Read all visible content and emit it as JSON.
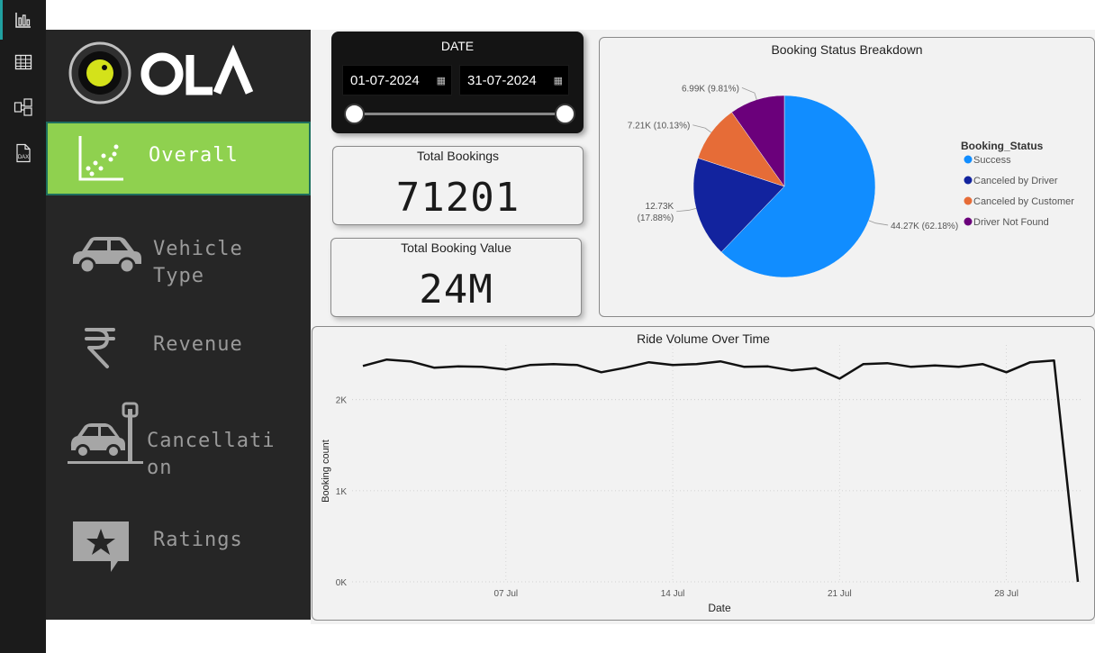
{
  "rail": {
    "items": [
      {
        "name": "report-view",
        "icon": "bar-chart-icon",
        "active": true
      },
      {
        "name": "table-view",
        "icon": "table-icon",
        "active": false
      },
      {
        "name": "model-view",
        "icon": "model-icon",
        "active": false
      },
      {
        "name": "dax-query-view",
        "icon": "dax-icon",
        "active": false,
        "label": "DAX"
      }
    ]
  },
  "brand": {
    "name": "OLA",
    "logo_color": "#d4e21a"
  },
  "nav": {
    "items": [
      {
        "label": "Overall",
        "icon": "scatter-chart-icon",
        "active": true
      },
      {
        "label_lines": [
          "Vehicle",
          "Type"
        ],
        "icon": "car-icon",
        "active": false
      },
      {
        "label": "Revenue",
        "icon": "rupee-icon",
        "active": false
      },
      {
        "label_lines": [
          "Cancellati",
          "on"
        ],
        "icon": "car-crash-icon",
        "active": false
      },
      {
        "label": "Ratings",
        "icon": "star-review-icon",
        "active": false
      }
    ]
  },
  "date_filter": {
    "title": "DATE",
    "start": "01-07-2024",
    "end": "31-07-2024"
  },
  "kpis": {
    "total_bookings": {
      "title": "Total Bookings",
      "value": "71201"
    },
    "total_booking_value": {
      "title": "Total Booking Value",
      "value": "24M"
    }
  },
  "colors": {
    "success": "#118dff",
    "canceled_by_driver": "#12239e",
    "canceled_by_customer": "#e66c37",
    "driver_not_found": "#6b007b",
    "active_nav": "#8fd14f"
  },
  "chart_data": [
    {
      "type": "pie",
      "title": "Booking Status Breakdown",
      "legend_title": "Booking_Status",
      "legend_position": "right",
      "slices": [
        {
          "name": "Success",
          "value": 44270,
          "label": "44.27K (62.18%)",
          "color": "#118dff"
        },
        {
          "name": "Canceled by Driver",
          "value": 12730,
          "label_lines": [
            "12.73K",
            "(17.88%)"
          ],
          "color": "#12239e"
        },
        {
          "name": "Canceled by Customer",
          "value": 7210,
          "label": "7.21K (10.13%)",
          "color": "#e66c37"
        },
        {
          "name": "Driver Not Found",
          "value": 6990,
          "label": "6.99K (9.81%)",
          "color": "#6b007b"
        }
      ]
    },
    {
      "type": "line",
      "title": "Ride Volume Over Time",
      "xlabel": "Date",
      "ylabel": "Booking count",
      "ylim": [
        0,
        2600
      ],
      "y_ticks": [
        "0K",
        "1K",
        "2K"
      ],
      "y_tick_values": [
        0,
        1000,
        2000
      ],
      "x_ticks": [
        "07 Jul",
        "14 Jul",
        "21 Jul",
        "28 Jul"
      ],
      "x_tick_days": [
        7,
        14,
        21,
        28
      ],
      "grid": true,
      "series": [
        {
          "days": [
            1,
            2,
            3,
            4,
            5,
            6,
            7,
            8,
            9,
            10,
            11,
            12,
            13,
            14,
            15,
            16,
            17,
            18,
            19,
            20,
            21,
            22,
            23,
            24,
            25,
            26,
            27,
            28,
            29,
            30,
            31
          ],
          "values": [
            2370,
            2440,
            2420,
            2350,
            2365,
            2360,
            2330,
            2380,
            2390,
            2380,
            2300,
            2350,
            2410,
            2380,
            2390,
            2420,
            2360,
            2365,
            2320,
            2345,
            2230,
            2390,
            2400,
            2360,
            2375,
            2360,
            2390,
            2300,
            2410,
            2430,
            0
          ]
        }
      ]
    }
  ]
}
